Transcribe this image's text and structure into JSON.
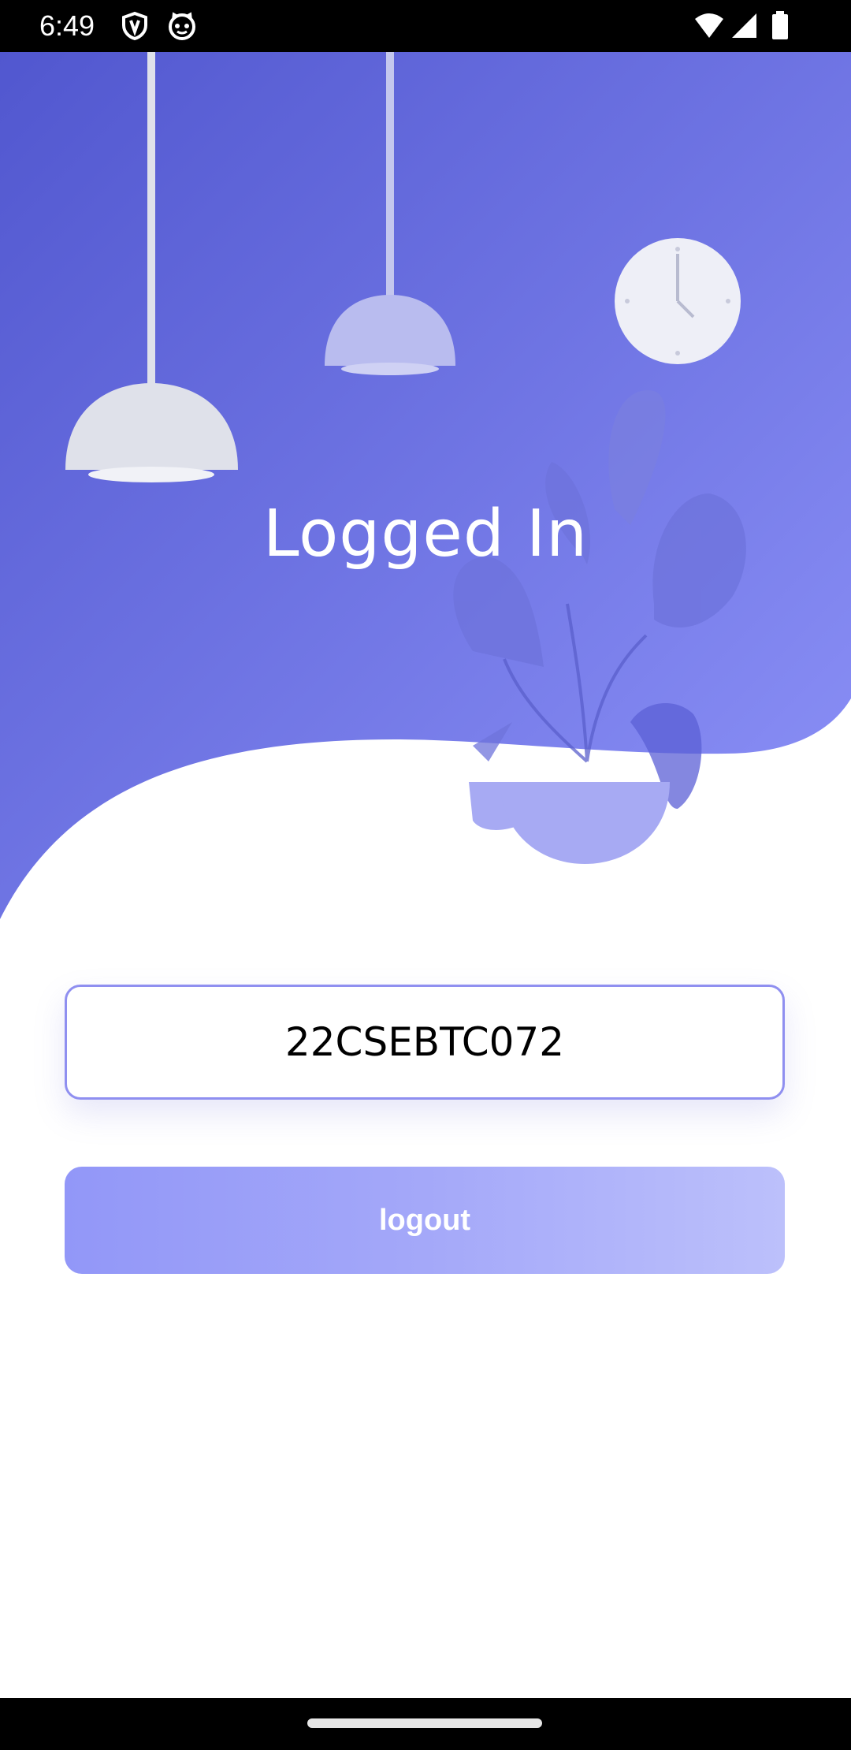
{
  "status_bar": {
    "time": "6:49",
    "icons": [
      "shield-icon",
      "cat-face-icon",
      "wifi-icon",
      "signal-icon",
      "battery-icon"
    ]
  },
  "header": {
    "title": "Logged In"
  },
  "form": {
    "user_value": "22CSEBTC072",
    "logout_label": "logout"
  },
  "colors": {
    "hero_gradient_start": "#5157cf",
    "hero_gradient_end": "#8d92f8",
    "field_border": "#8f8ff0",
    "button_gradient_start": "#9297f8",
    "button_gradient_end": "#bcc0fb"
  },
  "navigation": {
    "home_handle": "home-handle"
  }
}
